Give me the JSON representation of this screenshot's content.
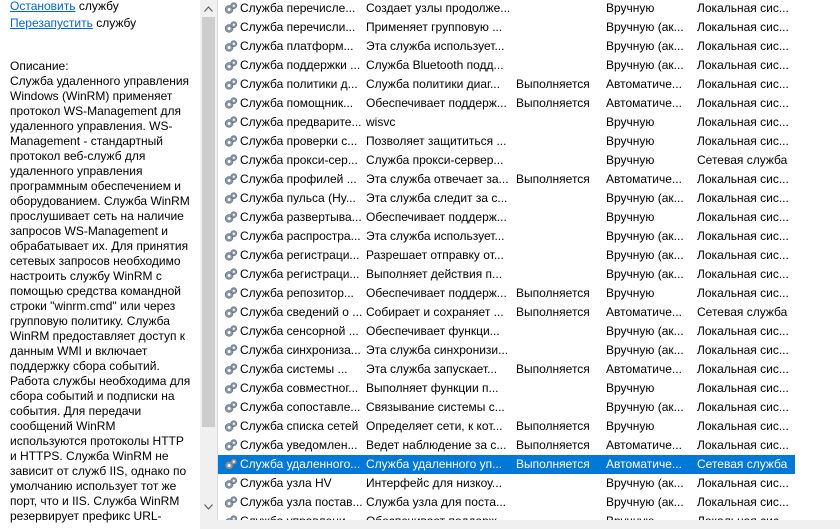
{
  "description_panel": {
    "actions": [
      {
        "link": "Остановить",
        "rest": " службу"
      },
      {
        "link": "Перезапустить",
        "rest": " службу"
      }
    ],
    "heading": "Описание:",
    "text": "Служба удаленного управления\nWindows (WinRM) применяет\nпротокол WS-Management для\nудаленного управления. WS-\nManagement - стандартный\nпротокол веб-служб для\nудаленного управления\nпрограммным обеспечением и\nоборудованием. Служба WinRM\nпрослушивает сеть на наличие\nзапросов WS-Management и\nобрабатывает их. Для принятия\nсетевых запросов необходимо\nнастроить службу WinRM с\nпомощью средства командной\nстроки \"winrm.cmd\" или через\nгрупповую политику. Служба\nWinRM предоставляет доступ к\nданным WMI и включает\nподдержку сбора событий.\nРабота службы необходима для\nсбора событий и подписки на\nсобытия. Для передачи\nсообщений WinRM\nиспользуются протоколы HTTP\nи HTTPS. Служба WinRM не\nзависит от служб IIS, однако по\nумолчанию использует тот же\nпорт, что и IIS.  Служба WinRM\nрезервирует префикс URL-"
  },
  "scrollbar": {
    "up_icon": "chevron-up-icon",
    "down_icon": "chevron-down-icon"
  },
  "colors": {
    "selection": "#0078d7",
    "link": "#0066cc"
  },
  "services": [
    {
      "name": "Служба перечисле...",
      "description": "Создает узлы продолже...",
      "status": "",
      "startup": "Вручную",
      "logon": "Локальная сис..."
    },
    {
      "name": "Служба перечисли...",
      "description": "Применяет групповую ...",
      "status": "",
      "startup": "Вручную (ак...",
      "logon": "Локальная сис..."
    },
    {
      "name": "Служба платформ...",
      "description": "Эта служба использует...",
      "status": "",
      "startup": "Вручную (ак...",
      "logon": "Локальная сис..."
    },
    {
      "name": "Служба поддержки ...",
      "description": "Служба Bluetooth подд...",
      "status": "",
      "startup": "Вручную (ак...",
      "logon": "Локальная сис..."
    },
    {
      "name": "Служба политики д...",
      "description": "Служба политики диаг...",
      "status": "Выполняется",
      "startup": "Автоматиче...",
      "logon": "Локальная сис..."
    },
    {
      "name": "Служба помощник...",
      "description": "Обеспечивает поддерж...",
      "status": "Выполняется",
      "startup": "Автоматиче...",
      "logon": "Локальная сис..."
    },
    {
      "name": "Служба предварите...",
      "description": "wisvc",
      "status": "",
      "startup": "Вручную",
      "logon": "Локальная сис..."
    },
    {
      "name": "Служба проверки с...",
      "description": "Позволяет защититься ...",
      "status": "",
      "startup": "Вручную",
      "logon": "Локальная сис..."
    },
    {
      "name": "Служба прокси-сер...",
      "description": "Служба прокси-сервер...",
      "status": "",
      "startup": "Вручную",
      "logon": "Сетевая служба"
    },
    {
      "name": "Служба профилей ...",
      "description": "Эта служба отвечает за...",
      "status": "Выполняется",
      "startup": "Автоматиче...",
      "logon": "Локальная сис..."
    },
    {
      "name": "Служба пульса (Hy...",
      "description": "Эта служба следит за с...",
      "status": "",
      "startup": "Вручную (ак...",
      "logon": "Локальная сис..."
    },
    {
      "name": "Служба развертыва...",
      "description": "Обеспечивает поддерж...",
      "status": "",
      "startup": "Вручную",
      "logon": "Локальная сис..."
    },
    {
      "name": "Служба распростра...",
      "description": "Эта служба использует...",
      "status": "",
      "startup": "Вручную (ак...",
      "logon": "Локальная сис..."
    },
    {
      "name": "Служба регистраци...",
      "description": "Разрешает отправку от...",
      "status": "",
      "startup": "Вручную (ак...",
      "logon": "Локальная сис..."
    },
    {
      "name": "Служба регистраци...",
      "description": "Выполняет действия п...",
      "status": "",
      "startup": "Вручную (ак...",
      "logon": "Локальная сис..."
    },
    {
      "name": "Служба репозитор...",
      "description": "Обеспечивает поддерж...",
      "status": "Выполняется",
      "startup": "Вручную",
      "logon": "Локальная сис..."
    },
    {
      "name": "Служба сведений о ...",
      "description": "Собирает и сохраняет ...",
      "status": "Выполняется",
      "startup": "Автоматиче...",
      "logon": "Сетевая служба"
    },
    {
      "name": "Служба сенсорной ...",
      "description": "Обеспечивает функци...",
      "status": "",
      "startup": "Вручную (ак...",
      "logon": "Локальная сис..."
    },
    {
      "name": "Служба синхрониза...",
      "description": "Эта служба синхронизи...",
      "status": "",
      "startup": "Вручную (ак...",
      "logon": "Локальная сис..."
    },
    {
      "name": "Служба системы ...",
      "description": "Эта служба запускает...",
      "status": "Выполняется",
      "startup": "Автоматиче...",
      "logon": "Локальная сис..."
    },
    {
      "name": "Служба совместног...",
      "description": "Выполняет функции п...",
      "status": "",
      "startup": "Вручную",
      "logon": "Локальная сис..."
    },
    {
      "name": "Служба сопоставле...",
      "description": "Связывание системы с...",
      "status": "",
      "startup": "Вручную (ак...",
      "logon": "Локальная сис..."
    },
    {
      "name": "Служба списка сетей",
      "description": "Определяет сети, к кот...",
      "status": "Выполняется",
      "startup": "Вручную",
      "logon": "Локальная сис..."
    },
    {
      "name": "Служба уведомлен...",
      "description": "Ведет наблюдение за с...",
      "status": "Выполняется",
      "startup": "Автоматиче...",
      "logon": "Локальная сис..."
    },
    {
      "name": "Служба удаленного...",
      "description": "Служба удаленного уп...",
      "status": "Выполняется",
      "startup": "Автоматиче...",
      "logon": "Сетевая служба",
      "selected": true
    },
    {
      "name": "Служба узла HV",
      "description": "Интерфейс для низкоу...",
      "status": "",
      "startup": "Вручную (ак...",
      "logon": "Локальная сис..."
    },
    {
      "name": "Служба узла постав...",
      "description": "Служба узла для поста...",
      "status": "",
      "startup": "Вручную (ак...",
      "logon": "Локальная сис..."
    },
    {
      "name": "Служба управлени...",
      "description": "Обеспечивает поддерж...",
      "status": "",
      "startup": "Вручную",
      "logon": "Локальная сис..."
    }
  ]
}
